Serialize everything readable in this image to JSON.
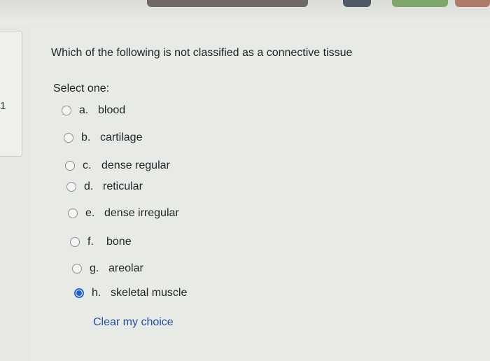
{
  "quiz": {
    "question_number": "1",
    "question_text": "Which of the following is not classified as a connective tissue",
    "prompt": "Select one:",
    "options": [
      {
        "letter": "a.",
        "label": "blood",
        "selected": false
      },
      {
        "letter": "b.",
        "label": "cartilage",
        "selected": false
      },
      {
        "letter": "c.",
        "label": "dense regular",
        "selected": false
      },
      {
        "letter": "d.",
        "label": "reticular",
        "selected": false
      },
      {
        "letter": "e.",
        "label": "dense irregular",
        "selected": false
      },
      {
        "letter": "f.",
        "label": "bone",
        "selected": false
      },
      {
        "letter": "g.",
        "label": "areolar",
        "selected": false
      },
      {
        "letter": "h.",
        "label": "skeletal muscle",
        "selected": true
      }
    ],
    "clear_choice": "Clear my choice"
  },
  "colors": {
    "background": "#e6e8e4",
    "radio_selected": "#1f5fcf",
    "link": "#1c4fa8"
  }
}
